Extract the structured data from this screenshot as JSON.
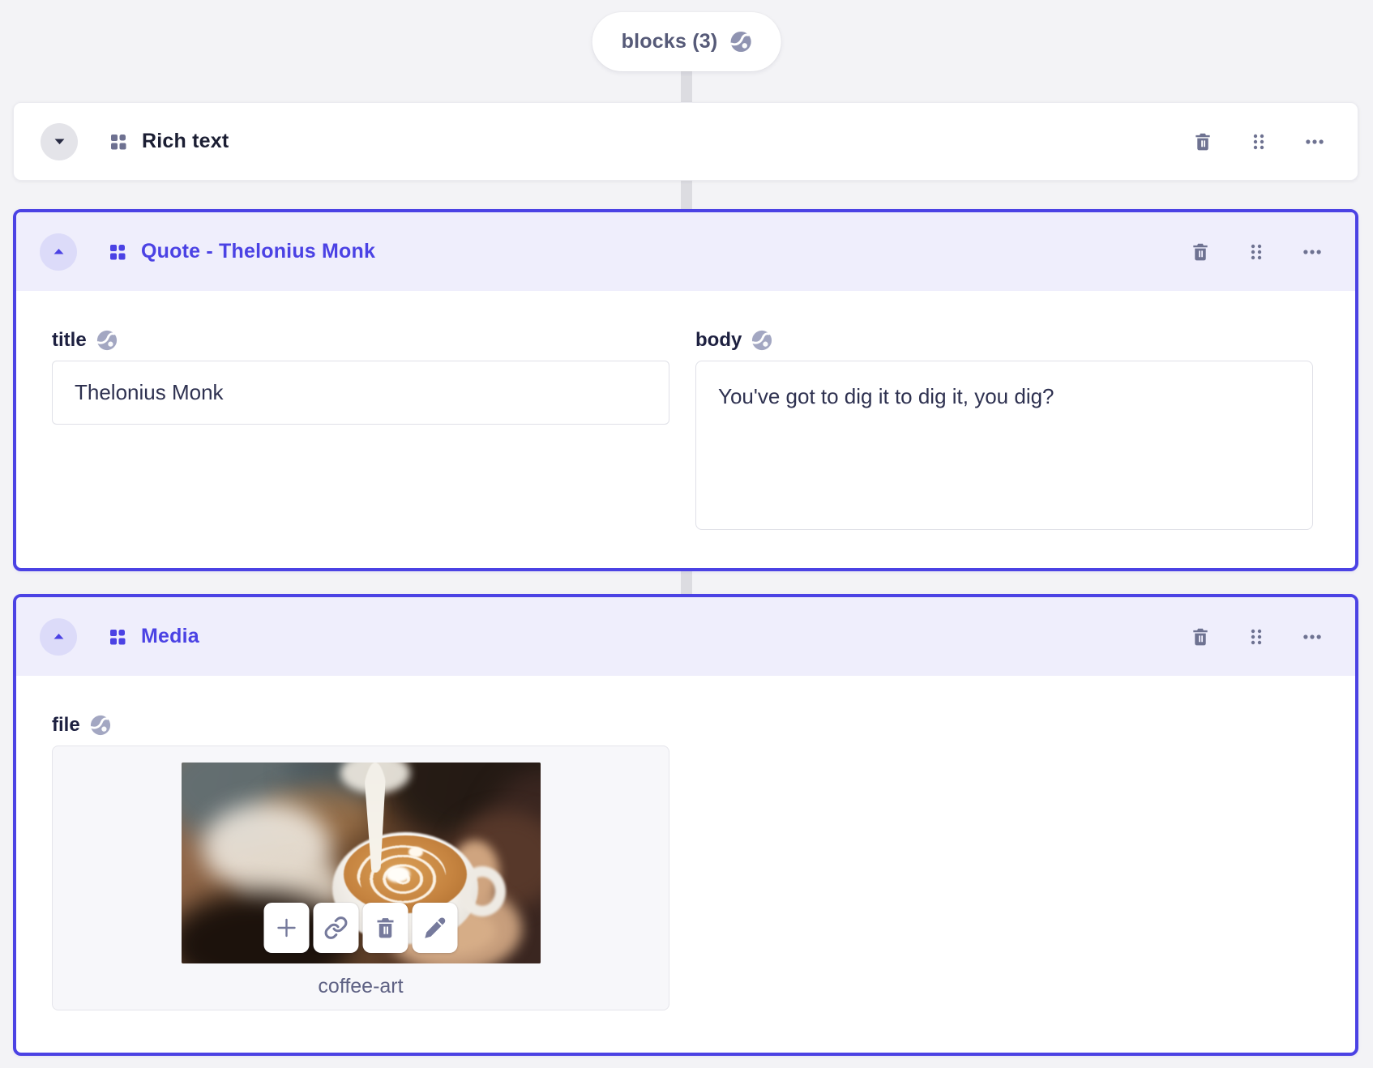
{
  "page": {
    "pill_label": "blocks (3)"
  },
  "blocks": [
    {
      "title": "Rich text",
      "state": "collapsed",
      "header_icons": [
        "block-type-grid-icon",
        "delete-icon",
        "drag-handle-icon",
        "menu-ellipsis-icon"
      ]
    },
    {
      "title": "Quote - Thelonius Monk",
      "state": "expanded-selected",
      "header_icons": [
        "block-type-grid-icon",
        "delete-icon",
        "drag-handle-icon",
        "menu-ellipsis-icon"
      ],
      "fields": {
        "title": {
          "label": "title",
          "value": "Thelonius Monk",
          "badge": "globe-icon"
        },
        "body": {
          "label": "body",
          "value": "You've got to dig it to dig it, you dig?",
          "badge": "globe-icon"
        }
      }
    },
    {
      "title": "Media",
      "state": "expanded-selected",
      "header_icons": [
        "block-type-grid-icon",
        "delete-icon",
        "drag-handle-icon",
        "menu-ellipsis-icon"
      ],
      "fields": {
        "file": {
          "label": "file",
          "badge": "globe-icon",
          "filename": "coffee-art",
          "preview": "latte-art-coffee-photo",
          "action_icons": [
            "plus-icon",
            "link-icon",
            "trash-icon",
            "pencil-icon"
          ]
        }
      }
    }
  ],
  "colors": {
    "accent": "#4b42e4",
    "accent_header_bg": "#efeefc",
    "accent_circle_bg": "#dcdbf9",
    "page_bg": "#f3f3f6",
    "connector": "#dcdce1",
    "icon_gray": "#6e7291",
    "title_dark": "#1b1e33",
    "label_dark": "#1d2040",
    "input_border": "#dfe0e7",
    "file_box_bg": "#f7f7fa"
  }
}
